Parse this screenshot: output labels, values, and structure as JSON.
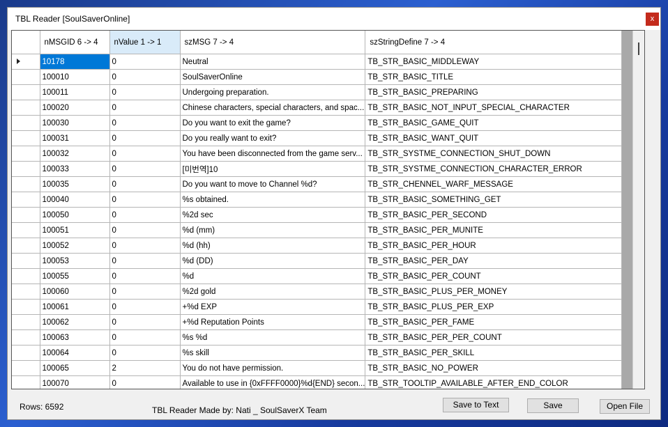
{
  "window": {
    "title": "TBL Reader [SoulSaverOnline]",
    "close_glyph": "x"
  },
  "grid": {
    "columns": [
      {
        "label": "nMSGID 6 -> 4"
      },
      {
        "label": "nValue 1 -> 1"
      },
      {
        "label": "szMSG 7 -> 4"
      },
      {
        "label": "szStringDefine 7 -> 4"
      }
    ],
    "rows": [
      [
        "10178",
        "0",
        "Neutral",
        "TB_STR_BASIC_MIDDLEWAY"
      ],
      [
        "100010",
        "0",
        "SoulSaverOnline",
        "TB_STR_BASIC_TITLE"
      ],
      [
        "100011",
        "0",
        "Undergoing preparation.",
        "TB_STR_BASIC_PREPARING"
      ],
      [
        "100020",
        "0",
        "Chinese characters, special characters, and spac...",
        "TB_STR_BASIC_NOT_INPUT_SPECIAL_CHARACTER"
      ],
      [
        "100030",
        "0",
        "Do you want to exit the game?",
        "TB_STR_BASIC_GAME_QUIT"
      ],
      [
        "100031",
        "0",
        "Do you really want to exit?",
        "TB_STR_BASIC_WANT_QUIT"
      ],
      [
        "100032",
        "0",
        "You have been disconnected from the game serv...",
        "TB_STR_SYSTME_CONNECTION_SHUT_DOWN"
      ],
      [
        "100033",
        "0",
        "[미번역]10",
        "TB_STR_SYSTME_CONNECTION_CHARACTER_ERROR"
      ],
      [
        "100035",
        "0",
        "Do you want to move to Channel %d?",
        "TB_STR_CHENNEL_WARF_MESSAGE"
      ],
      [
        "100040",
        "0",
        "%s obtained.",
        "TB_STR_BASIC_SOMETHING_GET"
      ],
      [
        "100050",
        "0",
        "%2d sec",
        "TB_STR_BASIC_PER_SECOND"
      ],
      [
        "100051",
        "0",
        "%d (mm)",
        "TB_STR_BASIC_PER_MUNITE"
      ],
      [
        "100052",
        "0",
        "%d (hh)",
        "TB_STR_BASIC_PER_HOUR"
      ],
      [
        "100053",
        "0",
        "%d (DD)",
        "TB_STR_BASIC_PER_DAY"
      ],
      [
        "100055",
        "0",
        "%d",
        "TB_STR_BASIC_PER_COUNT"
      ],
      [
        "100060",
        "0",
        "%2d gold",
        "TB_STR_BASIC_PLUS_PER_MONEY"
      ],
      [
        "100061",
        "0",
        "+%d EXP",
        "TB_STR_BASIC_PLUS_PER_EXP"
      ],
      [
        "100062",
        "0",
        "+%d Reputation Points",
        "TB_STR_BASIC_PER_FAME"
      ],
      [
        "100063",
        "0",
        "%s %d",
        "TB_STR_BASIC_PER_PER_COUNT"
      ],
      [
        "100064",
        "0",
        "%s skill",
        "TB_STR_BASIC_PER_SKILL"
      ],
      [
        "100065",
        "2",
        "You do not have permission.",
        "TB_STR_BASIC_NO_POWER"
      ],
      [
        "100070",
        "0",
        "Available to use in {0xFFFF0000}%d{END} secon...",
        "TB_STR_TOOLTIP_AVAILABLE_AFTER_END_COLOR"
      ]
    ]
  },
  "status": {
    "rows": "Rows: 6592",
    "credit": "TBL Reader Made by: Nati _ SoulSaverX Team"
  },
  "buttons": {
    "save_to_text": "Save to Text",
    "save": "Save",
    "open_file": "Open File"
  },
  "colors": {
    "selection": "#0078d7",
    "selected_column_header": "#d9ebf9",
    "close_button": "#c42b1c"
  }
}
